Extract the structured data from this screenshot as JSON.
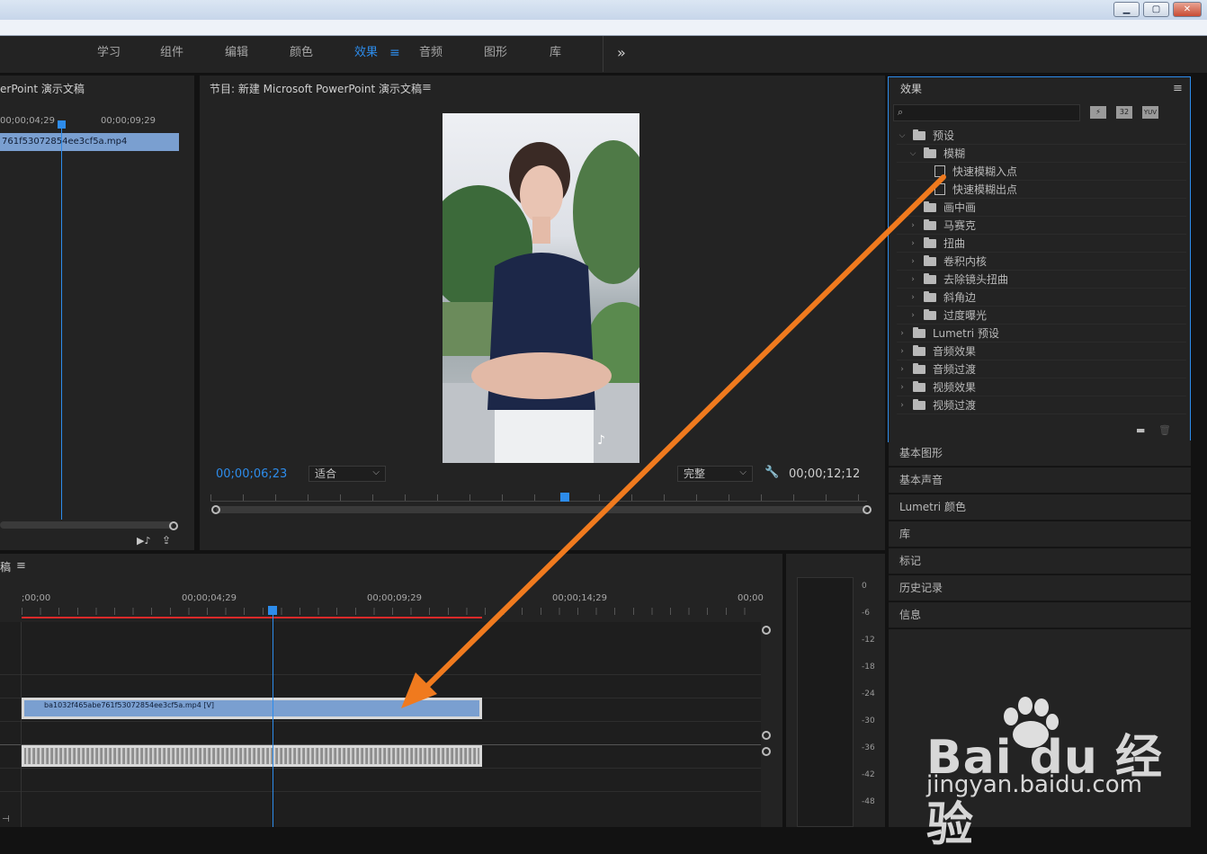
{
  "window": {
    "minimize": "▁",
    "maximize": "▢",
    "close": "✕"
  },
  "workspace": {
    "tabs": [
      "学习",
      "组件",
      "编辑",
      "颜色",
      "效果",
      "音频",
      "图形",
      "库"
    ],
    "active": "效果",
    "active_menu": "≡",
    "overflow": "»"
  },
  "source_panel": {
    "title": "erPoint 演示文稿",
    "tc_left": "00;00;04;29",
    "tc_right": "00;00;09;29",
    "clip": "761f53072854ee3cf5a.mp4"
  },
  "program_monitor": {
    "title": "节目: 新建 Microsoft PowerPoint 演示文稿",
    "menu": "≡",
    "current_tc": "00;00;06;23",
    "fit": "适合",
    "quality": "完整",
    "duration_tc": "00;00;12;12",
    "playhead_fraction": 0.54
  },
  "effects_panel": {
    "title": "效果",
    "menu": "≡",
    "search_placeholder": "",
    "badges": [
      "32",
      "YUV"
    ],
    "items": [
      {
        "label": "预设",
        "level": 0,
        "type": "folder",
        "open": true
      },
      {
        "label": "模糊",
        "level": 1,
        "type": "folder",
        "open": true
      },
      {
        "label": "快速模糊入点",
        "level": 2,
        "type": "preset"
      },
      {
        "label": "快速模糊出点",
        "level": 2,
        "type": "preset"
      },
      {
        "label": "画中画",
        "level": 1,
        "type": "folder",
        "open": false
      },
      {
        "label": "马赛克",
        "level": 1,
        "type": "folder",
        "open": false
      },
      {
        "label": "扭曲",
        "level": 1,
        "type": "folder",
        "open": false
      },
      {
        "label": "卷积内核",
        "level": 1,
        "type": "folder",
        "open": false
      },
      {
        "label": "去除镜头扭曲",
        "level": 1,
        "type": "folder",
        "open": false
      },
      {
        "label": "斜角边",
        "level": 1,
        "type": "folder",
        "open": false
      },
      {
        "label": "过度曝光",
        "level": 1,
        "type": "folder",
        "open": false
      },
      {
        "label": "Lumetri 预设",
        "level": 0,
        "type": "folder",
        "open": false
      },
      {
        "label": "音频效果",
        "level": 0,
        "type": "folder",
        "open": false
      },
      {
        "label": "音频过渡",
        "level": 0,
        "type": "folder",
        "open": false
      },
      {
        "label": "视频效果",
        "level": 0,
        "type": "folder",
        "open": false
      },
      {
        "label": "视频过渡",
        "level": 0,
        "type": "folder",
        "open": false
      }
    ]
  },
  "side_panels": [
    "基本图形",
    "基本声音",
    "Lumetri 颜色",
    "库",
    "标记",
    "历史记录",
    "信息"
  ],
  "timeline": {
    "title": "稿",
    "menu": "≡",
    "ticks": [
      ";00;00",
      "00;00;04;29",
      "00;00;09;29",
      "00;00;14;29",
      "00;00"
    ],
    "video_clip": "ba1032f465abe761f53072854ee3cf5a.mp4 [V]"
  },
  "audio_meter": {
    "labels": [
      "0",
      "-6",
      "-12",
      "-18",
      "-24",
      "-30",
      "-36",
      "-42",
      "-48"
    ]
  },
  "watermark": {
    "brand": "Bai du 经验",
    "url": "jingyan.baidu.com"
  },
  "colors": {
    "accent": "#2d8ceb",
    "arrow": "#f07a1e",
    "clip": "#7a9fd0",
    "panel": "#232323"
  }
}
